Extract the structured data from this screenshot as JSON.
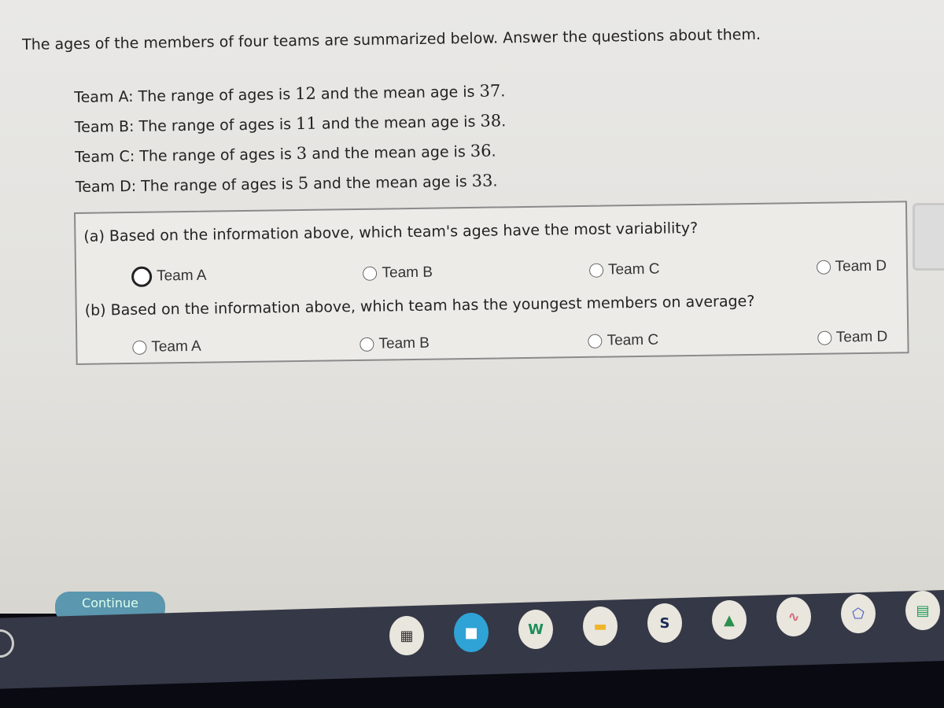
{
  "intro": "The ages of the members of four teams are summarized below. Answer the questions about them.",
  "teams": [
    {
      "label": "Team A: The range of ages is ",
      "range": "12",
      "mid": " and the mean age is ",
      "mean": "37",
      "end": "."
    },
    {
      "label": "Team B: The range of ages is ",
      "range": "11",
      "mid": " and the mean age is ",
      "mean": "38",
      "end": "."
    },
    {
      "label": "Team C: The range of ages is ",
      "range": "3",
      "mid": " and the mean age is ",
      "mean": "36",
      "end": "."
    },
    {
      "label": "Team D: The range of ages is ",
      "range": "5",
      "mid": " and the mean age is ",
      "mean": "33",
      "end": "."
    }
  ],
  "questions": [
    {
      "text": "(a) Based on the information above, which team's ages have the most variability?",
      "options": [
        "Team A",
        "Team B",
        "Team C",
        "Team D"
      ]
    },
    {
      "text": "(b) Based on the information above, which team has the youngest members on average?",
      "options": [
        "Team A",
        "Team B",
        "Team C",
        "Team D"
      ]
    }
  ],
  "continue_label": "Continue",
  "shelf_apps": [
    "calculator-icon",
    "zoom-icon",
    "classroom-icon",
    "slides-icon",
    "schoology-icon",
    "drive-icon",
    "graph-icon",
    "geometry-icon",
    "sheets-icon"
  ],
  "colors": {
    "shelf": "#353846",
    "continue": "#5b97ae"
  }
}
